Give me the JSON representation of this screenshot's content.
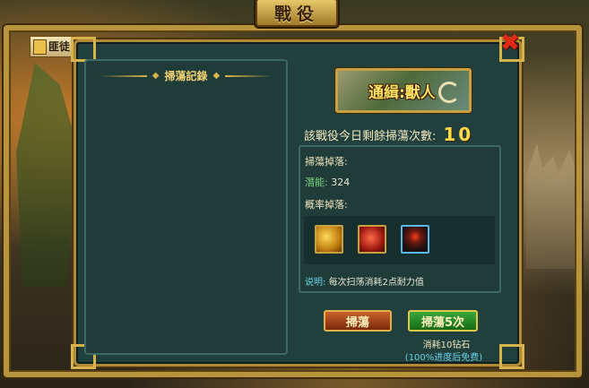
{
  "window": {
    "title": "戰役"
  },
  "tab": {
    "label": "匪徒"
  },
  "log_panel": {
    "title": "掃蕩記錄"
  },
  "target": {
    "name": "通緝:獸人"
  },
  "remaining": {
    "label": "該戰役今日剩餘掃蕩次數:",
    "value": "10"
  },
  "drops": {
    "title": "掃蕩掉落:",
    "potential_label": "潛能:",
    "potential_value": "324",
    "chance_title": "概率掉落:",
    "items": [
      "gold-coin-item",
      "red-gem-item",
      "dark-mage-item"
    ]
  },
  "note": {
    "label": "说明:",
    "text": "每次扫荡消耗2点耐力值"
  },
  "buttons": {
    "sweep": "掃蕩",
    "sweep5": "掃蕩5次"
  },
  "cost": {
    "text": "消耗10钻石",
    "note": "(100%进度后免费)"
  },
  "colors": {
    "accent_gold": "#d8b24a",
    "panel": "#21403d",
    "close": "#e02a14"
  }
}
